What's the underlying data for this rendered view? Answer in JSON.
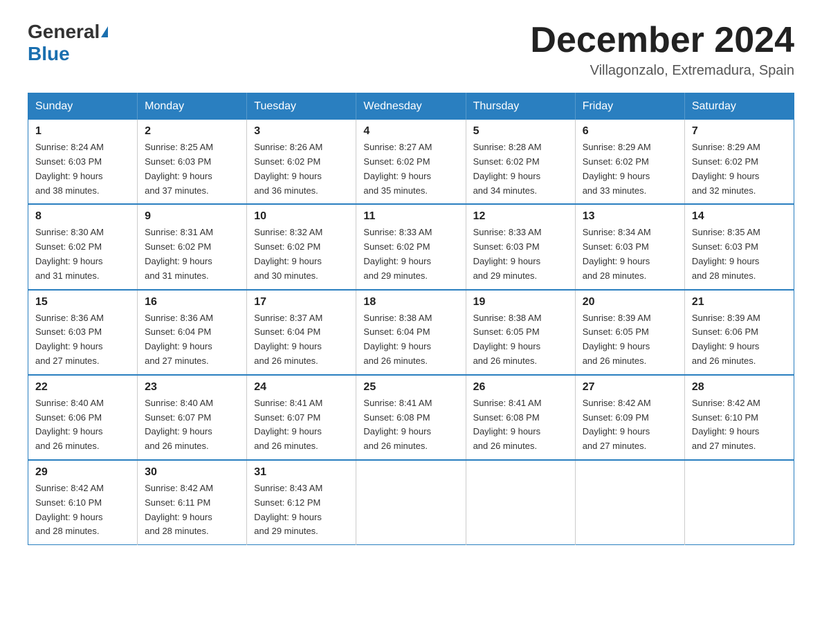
{
  "header": {
    "logo_general": "General",
    "logo_blue": "Blue",
    "month_title": "December 2024",
    "location": "Villagonzalo, Extremadura, Spain"
  },
  "weekdays": [
    "Sunday",
    "Monday",
    "Tuesday",
    "Wednesday",
    "Thursday",
    "Friday",
    "Saturday"
  ],
  "weeks": [
    [
      {
        "day": "1",
        "sunrise": "8:24 AM",
        "sunset": "6:03 PM",
        "daylight": "9 hours and 38 minutes."
      },
      {
        "day": "2",
        "sunrise": "8:25 AM",
        "sunset": "6:03 PM",
        "daylight": "9 hours and 37 minutes."
      },
      {
        "day": "3",
        "sunrise": "8:26 AM",
        "sunset": "6:02 PM",
        "daylight": "9 hours and 36 minutes."
      },
      {
        "day": "4",
        "sunrise": "8:27 AM",
        "sunset": "6:02 PM",
        "daylight": "9 hours and 35 minutes."
      },
      {
        "day": "5",
        "sunrise": "8:28 AM",
        "sunset": "6:02 PM",
        "daylight": "9 hours and 34 minutes."
      },
      {
        "day": "6",
        "sunrise": "8:29 AM",
        "sunset": "6:02 PM",
        "daylight": "9 hours and 33 minutes."
      },
      {
        "day": "7",
        "sunrise": "8:29 AM",
        "sunset": "6:02 PM",
        "daylight": "9 hours and 32 minutes."
      }
    ],
    [
      {
        "day": "8",
        "sunrise": "8:30 AM",
        "sunset": "6:02 PM",
        "daylight": "9 hours and 31 minutes."
      },
      {
        "day": "9",
        "sunrise": "8:31 AM",
        "sunset": "6:02 PM",
        "daylight": "9 hours and 31 minutes."
      },
      {
        "day": "10",
        "sunrise": "8:32 AM",
        "sunset": "6:02 PM",
        "daylight": "9 hours and 30 minutes."
      },
      {
        "day": "11",
        "sunrise": "8:33 AM",
        "sunset": "6:02 PM",
        "daylight": "9 hours and 29 minutes."
      },
      {
        "day": "12",
        "sunrise": "8:33 AM",
        "sunset": "6:03 PM",
        "daylight": "9 hours and 29 minutes."
      },
      {
        "day": "13",
        "sunrise": "8:34 AM",
        "sunset": "6:03 PM",
        "daylight": "9 hours and 28 minutes."
      },
      {
        "day": "14",
        "sunrise": "8:35 AM",
        "sunset": "6:03 PM",
        "daylight": "9 hours and 28 minutes."
      }
    ],
    [
      {
        "day": "15",
        "sunrise": "8:36 AM",
        "sunset": "6:03 PM",
        "daylight": "9 hours and 27 minutes."
      },
      {
        "day": "16",
        "sunrise": "8:36 AM",
        "sunset": "6:04 PM",
        "daylight": "9 hours and 27 minutes."
      },
      {
        "day": "17",
        "sunrise": "8:37 AM",
        "sunset": "6:04 PM",
        "daylight": "9 hours and 26 minutes."
      },
      {
        "day": "18",
        "sunrise": "8:38 AM",
        "sunset": "6:04 PM",
        "daylight": "9 hours and 26 minutes."
      },
      {
        "day": "19",
        "sunrise": "8:38 AM",
        "sunset": "6:05 PM",
        "daylight": "9 hours and 26 minutes."
      },
      {
        "day": "20",
        "sunrise": "8:39 AM",
        "sunset": "6:05 PM",
        "daylight": "9 hours and 26 minutes."
      },
      {
        "day": "21",
        "sunrise": "8:39 AM",
        "sunset": "6:06 PM",
        "daylight": "9 hours and 26 minutes."
      }
    ],
    [
      {
        "day": "22",
        "sunrise": "8:40 AM",
        "sunset": "6:06 PM",
        "daylight": "9 hours and 26 minutes."
      },
      {
        "day": "23",
        "sunrise": "8:40 AM",
        "sunset": "6:07 PM",
        "daylight": "9 hours and 26 minutes."
      },
      {
        "day": "24",
        "sunrise": "8:41 AM",
        "sunset": "6:07 PM",
        "daylight": "9 hours and 26 minutes."
      },
      {
        "day": "25",
        "sunrise": "8:41 AM",
        "sunset": "6:08 PM",
        "daylight": "9 hours and 26 minutes."
      },
      {
        "day": "26",
        "sunrise": "8:41 AM",
        "sunset": "6:08 PM",
        "daylight": "9 hours and 26 minutes."
      },
      {
        "day": "27",
        "sunrise": "8:42 AM",
        "sunset": "6:09 PM",
        "daylight": "9 hours and 27 minutes."
      },
      {
        "day": "28",
        "sunrise": "8:42 AM",
        "sunset": "6:10 PM",
        "daylight": "9 hours and 27 minutes."
      }
    ],
    [
      {
        "day": "29",
        "sunrise": "8:42 AM",
        "sunset": "6:10 PM",
        "daylight": "9 hours and 28 minutes."
      },
      {
        "day": "30",
        "sunrise": "8:42 AM",
        "sunset": "6:11 PM",
        "daylight": "9 hours and 28 minutes."
      },
      {
        "day": "31",
        "sunrise": "8:43 AM",
        "sunset": "6:12 PM",
        "daylight": "9 hours and 29 minutes."
      },
      null,
      null,
      null,
      null
    ]
  ],
  "labels": {
    "sunrise": "Sunrise:",
    "sunset": "Sunset:",
    "daylight": "Daylight:"
  }
}
